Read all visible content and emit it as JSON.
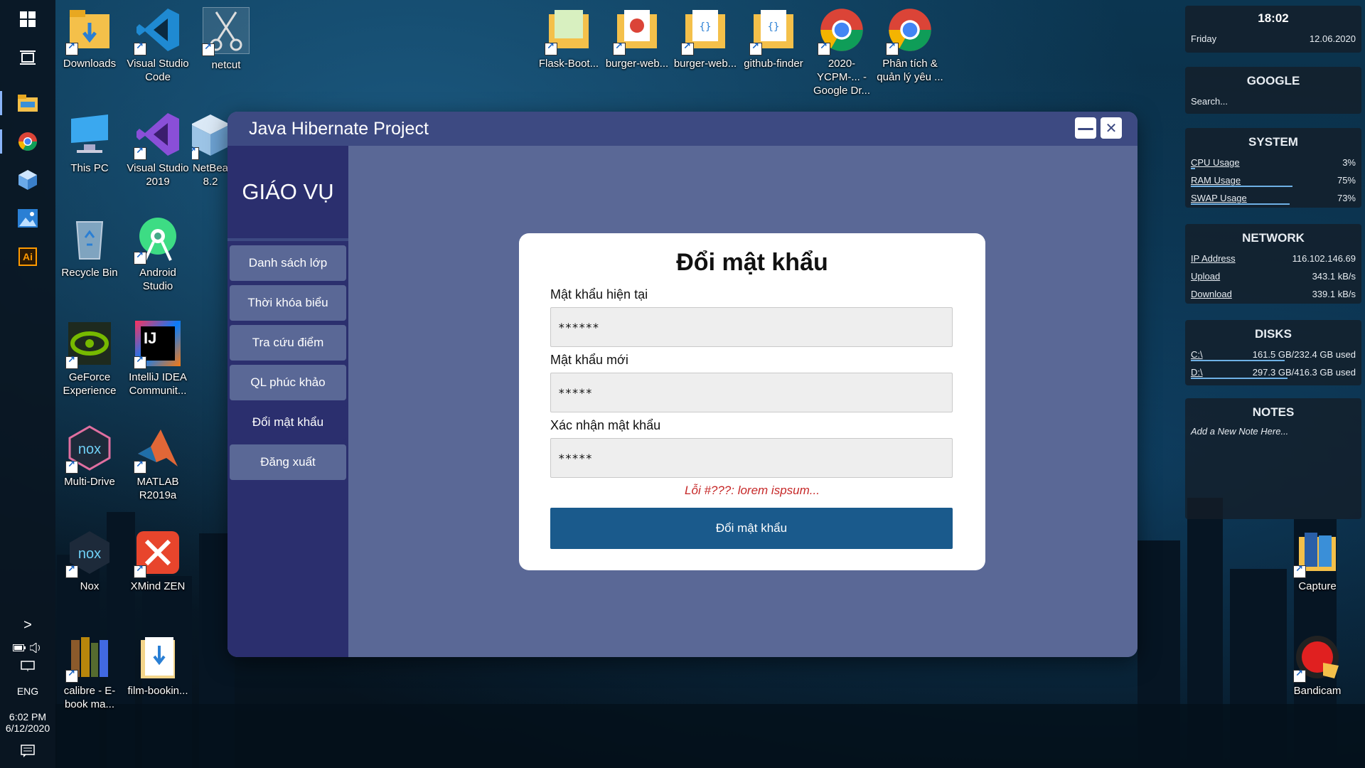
{
  "taskbar": {
    "icons": [
      "windows-start-icon",
      "task-view-icon",
      "file-explorer-icon",
      "chrome-icon",
      "3d-box-icon",
      "photos-icon",
      "illustrator-icon"
    ],
    "illustrator_label": "Ai",
    "lang": "ENG",
    "time": "6:02 PM",
    "date": "6/12/2020",
    "chevron": ">"
  },
  "desktop": {
    "icons": [
      {
        "label": "Downloads"
      },
      {
        "label": "Visual Studio Code"
      },
      {
        "label": "netcut"
      },
      {
        "label": "This PC"
      },
      {
        "label": "Visual Studio 2019"
      },
      {
        "label": "NetBea 8.2"
      },
      {
        "label": "Recycle Bin"
      },
      {
        "label": "Android Studio"
      },
      {
        "label": "GeForce Experience"
      },
      {
        "label": "IntelliJ IDEA Communit..."
      },
      {
        "label": "Multi-Drive"
      },
      {
        "label": "MATLAB R2019a"
      },
      {
        "label": "Nox"
      },
      {
        "label": "XMind ZEN"
      },
      {
        "label": "calibre - E-book ma..."
      },
      {
        "label": "film-bookin..."
      },
      {
        "label": "Flask-Boot..."
      },
      {
        "label": "burger-web..."
      },
      {
        "label": "burger-web..."
      },
      {
        "label": "github-finder"
      },
      {
        "label": "2020-YCPM-... - Google Dr..."
      },
      {
        "label": "Phân tích & quản lý yêu ..."
      },
      {
        "label": "Capture"
      },
      {
        "label": "Bandicam"
      }
    ],
    "intellij_glyph": "IJ",
    "nox_glyph": "nox"
  },
  "window": {
    "title": "Java Hibernate Project",
    "minimize": "—",
    "close": "✕",
    "sidebar": {
      "title": "GIÁO VỤ",
      "items": [
        {
          "label": "Danh sách lớp"
        },
        {
          "label": "Thời khóa biểu"
        },
        {
          "label": "Tra cứu điểm"
        },
        {
          "label": "QL phúc khảo"
        },
        {
          "label": "Đổi mật khẩu"
        },
        {
          "label": "Đăng xuất"
        }
      ],
      "active_index": 4
    },
    "form": {
      "title": "Đổi mật khẩu",
      "current_label": "Mật khẩu hiện tại",
      "current_value": "******",
      "new_label": "Mật khẩu mới",
      "new_value": "*****",
      "confirm_label": "Xác nhận mật khẩu",
      "confirm_value": "*****",
      "error": "Lỗi #???: lorem ispsum...",
      "submit": "Đổi mật khẩu"
    }
  },
  "widgets": {
    "clock": {
      "time": "18:02",
      "day": "Friday",
      "date": "12.06.2020"
    },
    "google": {
      "title": "GOOGLE",
      "placeholder": "Search..."
    },
    "system": {
      "title": "SYSTEM",
      "rows": [
        {
          "k": "CPU Usage",
          "v": "3%",
          "level": 0.03
        },
        {
          "k": "RAM Usage",
          "v": "75%",
          "level": 0.75
        },
        {
          "k": "SWAP Usage",
          "v": "73%",
          "level": 0.73
        }
      ]
    },
    "network": {
      "title": "NETWORK",
      "rows": [
        {
          "k": "IP Address",
          "v": "116.102.146.69"
        },
        {
          "k": "Upload",
          "v": "343.1 kB/s"
        },
        {
          "k": "Download",
          "v": "339.1 kB/s"
        }
      ]
    },
    "disks": {
      "title": "DISKS",
      "rows": [
        {
          "k": "C:\\",
          "v": "161.5 GB/232.4 GB used",
          "level": 0.695
        },
        {
          "k": "D:\\",
          "v": "297.3 GB/416.3 GB used",
          "level": 0.714
        }
      ]
    },
    "notes": {
      "title": "NOTES",
      "placeholder": "Add a New Note Here..."
    }
  },
  "colors": {
    "window_bg": "#5a6896",
    "titlebar": "#3d4a82",
    "sidebar": "#2b2f6e",
    "submit": "#1a5a8c",
    "error": "#c62828"
  }
}
